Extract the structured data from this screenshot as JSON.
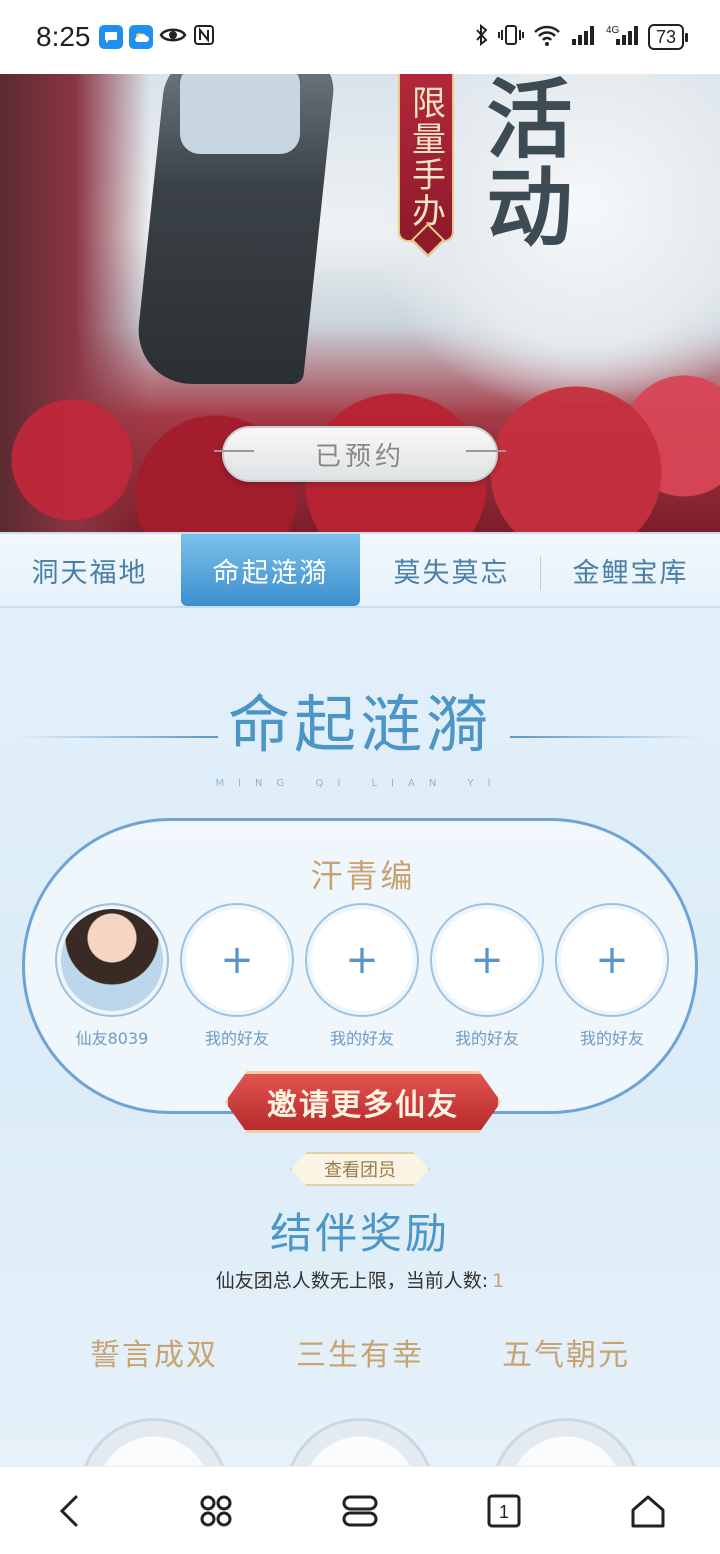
{
  "status_bar": {
    "time": "8:25",
    "battery": "73",
    "icons_left": [
      "message-icon",
      "weather-icon",
      "eye-icon",
      "nfc-icon"
    ],
    "icons_right": [
      "bluetooth-icon",
      "vibrate-icon",
      "wifi-icon",
      "signal-icon",
      "4g-signal-icon",
      "battery-icon"
    ]
  },
  "hero": {
    "ribbon_text": "限量手办",
    "title_text": "活动",
    "reserve_button": "已预约"
  },
  "tabs": [
    {
      "label": "洞天福地",
      "active": false
    },
    {
      "label": "命起涟漪",
      "active": true
    },
    {
      "label": "莫失莫忘",
      "active": false
    },
    {
      "label": "金鲤宝库",
      "active": false
    }
  ],
  "section": {
    "title": "命起涟漪",
    "subtitle": "MING QI LIAN YI"
  },
  "team": {
    "name": "汗青编",
    "slots": [
      {
        "label": "仙友8039",
        "filled": true
      },
      {
        "label": "我的好友",
        "filled": false
      },
      {
        "label": "我的好友",
        "filled": false
      },
      {
        "label": "我的好友",
        "filled": false
      },
      {
        "label": "我的好友",
        "filled": false
      }
    ],
    "plus": "+",
    "invite_button": "邀请更多仙友",
    "view_members": "查看团员"
  },
  "reward": {
    "title": "结伴奖励",
    "desc": "仙友团总人数无上限，当前人数:",
    "count": "1",
    "items": [
      "誓言成双",
      "三生有幸",
      "五气朝元"
    ]
  },
  "nav": [
    "back-icon",
    "apps-icon",
    "tabs-switch-icon",
    "tab-count-icon",
    "home-icon"
  ],
  "nav_tab_count": "1",
  "colors": {
    "accent_blue": "#4b95c7",
    "gold": "#c7a372",
    "invite_red": "#c0302f"
  }
}
